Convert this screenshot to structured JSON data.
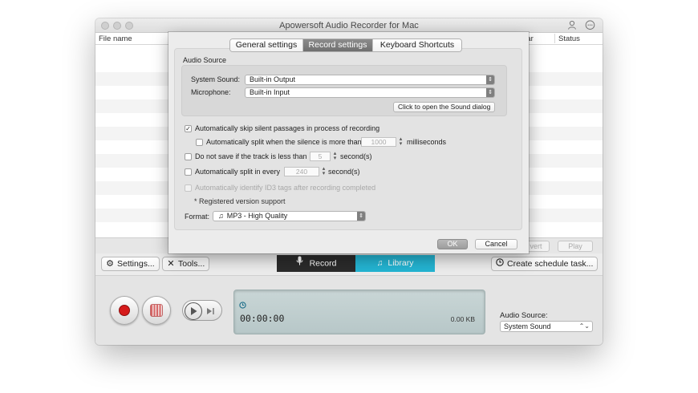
{
  "window": {
    "title": "Apowersoft Audio Recorder for Mac"
  },
  "table": {
    "columns": [
      "File name",
      "ear",
      "Status"
    ],
    "footer_buttons": [
      "vert",
      "Play"
    ]
  },
  "toolbar": {
    "settings_label": "Settings...",
    "tools_label": "Tools...",
    "record_label": "Record",
    "library_label": "Library",
    "schedule_label": "Create schedule task..."
  },
  "recorder": {
    "time": "00:00:00",
    "size": "0.00 KB",
    "audio_source_label": "Audio Source:",
    "audio_source_value": "System Sound"
  },
  "settings_dialog": {
    "tabs": [
      "General settings",
      "Record settings",
      "Keyboard Shortcuts"
    ],
    "active_tab": "Record settings",
    "audio_source_group": "Audio Source",
    "system_sound_label": "System Sound:",
    "system_sound_value": "Built-in Output",
    "microphone_label": "Microphone:",
    "microphone_value": "Built-in Input",
    "sound_dialog_button": "Click to open the Sound dialog",
    "options": {
      "skip_silent": {
        "label": "Automatically skip silent passages in process of recording",
        "checked": true
      },
      "split_silence": {
        "label": "Automatically split when the silence is more than",
        "value": "1000",
        "unit": "milliseconds",
        "checked": false
      },
      "min_track": {
        "label": "Do not save if the track is less than",
        "value": "5",
        "unit": "second(s)",
        "checked": false
      },
      "split_every": {
        "label": "Automatically split in every",
        "value": "240",
        "unit": "second(s)",
        "checked": false
      },
      "id3": {
        "label": "Automatically identify ID3 tags after recording completed",
        "checked": false,
        "enabled": false
      }
    },
    "registered_note": "* Registered version support",
    "format_label": "Format:",
    "format_value": "MP3  - High Quality",
    "ok_label": "OK",
    "cancel_label": "Cancel"
  },
  "colors": {
    "record_tab_bg": "#2b2b2b",
    "library_tab_bg": "#24b4d2",
    "record_button": "#d61b1b",
    "display_bg": "#c0cfd0"
  }
}
